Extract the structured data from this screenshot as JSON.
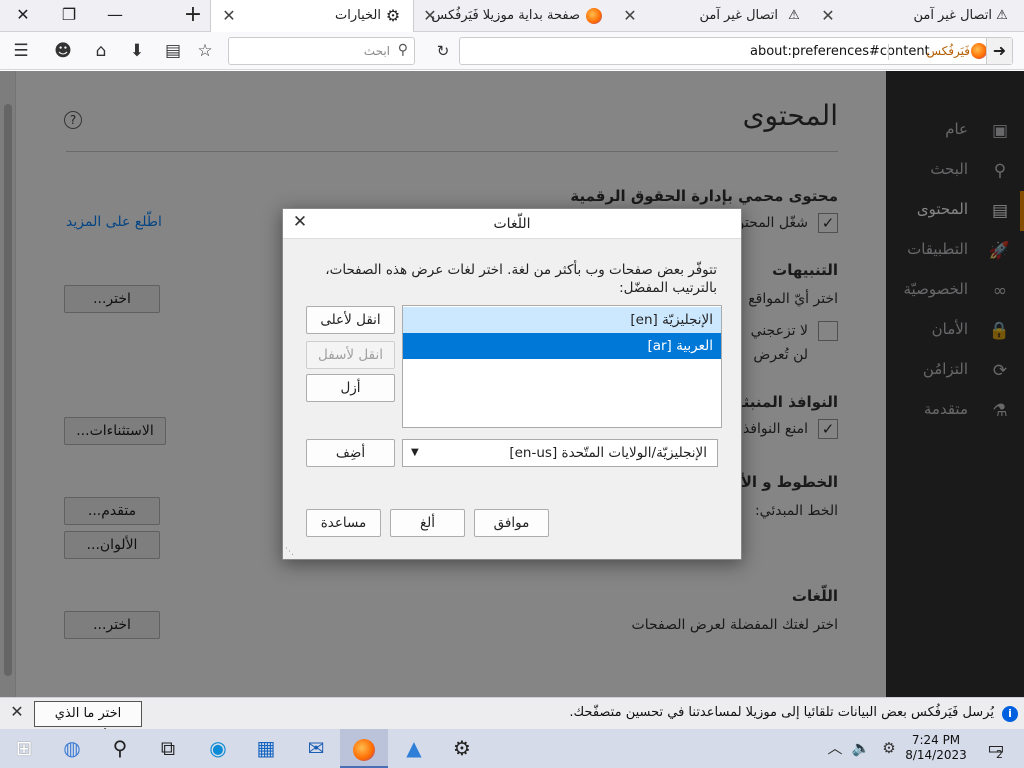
{
  "tabs": [
    {
      "label": "الخيارات",
      "icon": "gear-icon",
      "active": true
    },
    {
      "label": "صفحة بداية موزيلا فَيَرفُكس",
      "icon": "firefox-icon"
    },
    {
      "label": "اتصال غير آمن",
      "icon": "warning-icon"
    },
    {
      "label": "اتصال غير آمن",
      "icon": "warning-icon"
    }
  ],
  "window_controls": {
    "close": "✕",
    "restore": "❐",
    "minimize": "—",
    "new_tab": "+"
  },
  "navbar": {
    "url": "about:preferences#content",
    "brand_label": "فَيَرفُكس",
    "search_placeholder": "ابحث"
  },
  "sidebar": {
    "items": [
      {
        "label": "عام",
        "icon": "general-icon"
      },
      {
        "label": "البحث",
        "icon": "search-icon"
      },
      {
        "label": "المحتوى",
        "icon": "content-icon",
        "selected": true
      },
      {
        "label": "التطبيقات",
        "icon": "applications-icon"
      },
      {
        "label": "الخصوصيّة",
        "icon": "privacy-mask-icon"
      },
      {
        "label": "الأمان",
        "icon": "security-lock-icon"
      },
      {
        "label": "التزامُن",
        "icon": "sync-icon"
      },
      {
        "label": "متقدمة",
        "icon": "advanced-icon"
      }
    ]
  },
  "prefs": {
    "title": "المحتوى",
    "drm_heading": "محتوى محمي بإدارة الحقوق الرقمية",
    "drm_checkbox": "شغّل المحتوى",
    "drm_link": "اطّلع على المزيد",
    "notifications_heading": "التنبيهات",
    "notifications_text": "اختر أيّ المواقع",
    "dnd_text_1": "لا تزعجني",
    "dnd_text_2": "لن تُعرض",
    "choose_button": "اختر...",
    "popups_heading": "النوافذ المنبثقة",
    "popups_checkbox": "امنع النوافذ",
    "exceptions_button": "الاستثناءات...",
    "fonts_heading": "الخطوط و الألوان",
    "default_font": "الخط المبدئي:",
    "advanced_button": "متقدم...",
    "colors_button": "الألوان...",
    "languages_heading": "اللّغات",
    "languages_text": "اختر لغتك المفضلة لعرض الصفحات",
    "choose_button_2": "اختر..."
  },
  "dialog": {
    "title": "اللّغات",
    "description": "تتوفّر بعض صفحات وب بأكثر من لغة. اختر لغات عرض هذه الصفحات، بالترتيب المفضّل:",
    "languages": [
      {
        "label": "الإنجليزيّة  [en]",
        "state": "hover"
      },
      {
        "label": "العربية  [ar]",
        "state": "selected"
      }
    ],
    "move_up": "انقل لأعلى",
    "move_down": "انقل لأسفل",
    "remove": "أزل",
    "select_value": "الإنجليزيّة/الولايات المتّحدة  [en-us]",
    "add": "أضِف",
    "ok": "موافق",
    "cancel": "ألغ",
    "help": "مساعدة"
  },
  "notification": {
    "message": "يُرسل فَيَرفُكس بعض البيانات تلقائيا إلى موزيلا لمساعدتنا في تحسين متصفّحك.",
    "button": "اختر ما الذي أشاركه"
  },
  "taskbar": {
    "time": "7:24 PM",
    "date": "8/14/2023",
    "notification_count": "2"
  }
}
